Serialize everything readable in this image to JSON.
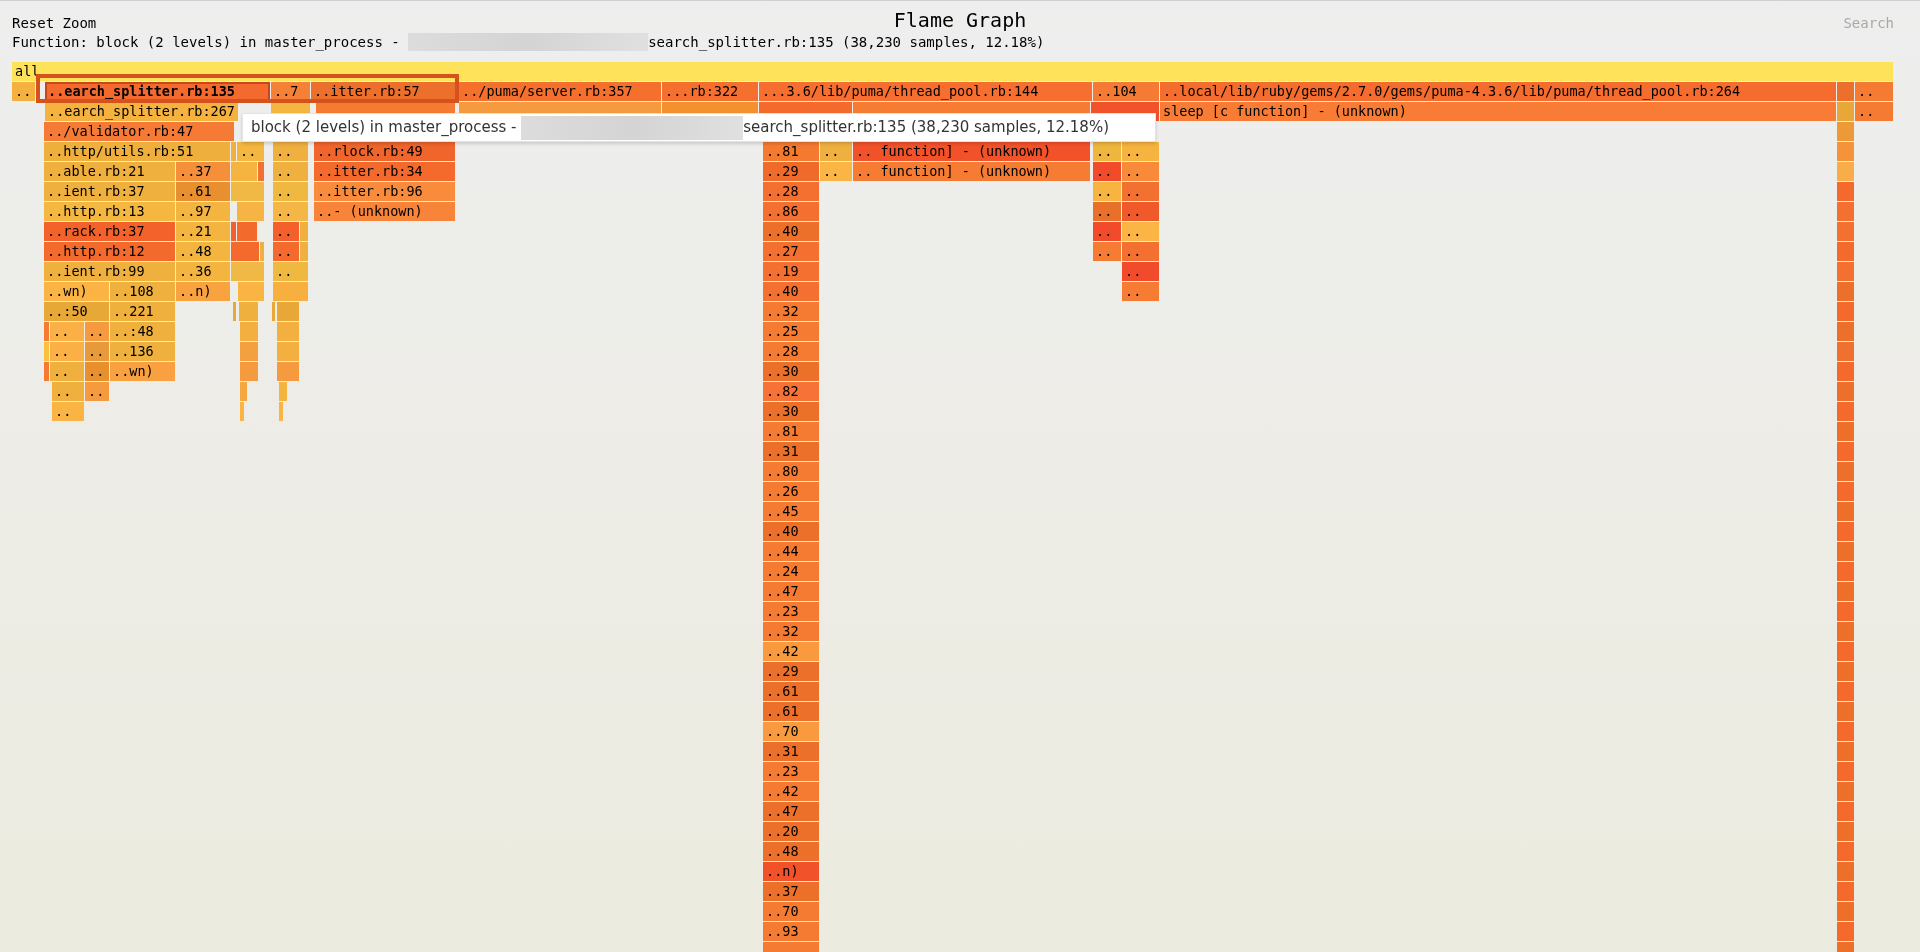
{
  "header": {
    "reset_zoom": "Reset Zoom",
    "title": "Flame Graph",
    "search": "Search"
  },
  "details": {
    "prefix": "Function: block (2 levels) in master_process - ",
    "redacted": true,
    "suffix": "search_splitter.rb:135 (38,230 samples, 12.18%)"
  },
  "tooltip": {
    "prefix": "block (2 levels) in master_process - ",
    "redacted": true,
    "suffix": "search_splitter.rb:135 (38,230 samples, 12.18%)"
  },
  "flame": {
    "rows": [
      {
        "frames": [
          {
            "label": "all",
            "color": "#fde25a",
            "selected": false
          }
        ]
      },
      {
        "frames": [
          {
            "label": "..",
            "color": "#f5b13f",
            "selected": false
          },
          {
            "label": "..earch_splitter.rb:135",
            "color": "#f46a2e",
            "selected": true
          },
          {
            "label": "..7",
            "color": "#f58136",
            "selected": false
          },
          {
            "label": "..itter.rb:57",
            "color": "#ec6f2b",
            "selected": false
          },
          {
            "label": "../puma/server.rb:357",
            "color": "#f5702c",
            "selected": false
          },
          {
            "label": "...rb:322",
            "color": "#f5702f",
            "selected": false
          },
          {
            "label": "...3.6/lib/puma/thread_pool.rb:144",
            "color": "#f76f30",
            "selected": false
          },
          {
            "label": "..104",
            "color": "#f57a33",
            "selected": false
          },
          {
            "label": "..local/lib/ruby/gems/2.7.0/gems/puma-4.3.6/lib/puma/thread_pool.rb:264",
            "color": "#f46d2e",
            "selected": false
          },
          {
            "color": "#ec6f2b",
            "selected": false
          },
          {
            "label": "..",
            "color": "#f57a32",
            "selected": false
          }
        ]
      },
      {
        "frames": [
          {
            "label": "..earch_splitter.rb:267",
            "color": "#f5b23f",
            "selected": false
          },
          {
            "color": "#f3b640",
            "selected": false
          },
          {
            "color": "#f57a32",
            "selected": false
          },
          {
            "color": "#f59a3e",
            "selected": false
          },
          {
            "color": "#f5902f",
            "selected": false
          },
          {
            "color": "#f46a2c",
            "selected": false
          },
          {
            "color": "#f67c34",
            "selected": false
          },
          {
            "color": "#f2522a",
            "selected": false
          },
          {
            "label": "sleep [c function] - (unknown)",
            "color": "#f87c36",
            "selected": false
          },
          {
            "color": "#e8a838",
            "selected": false
          },
          {
            "label": "..",
            "color": "#f57a32",
            "selected": false
          }
        ]
      },
      {
        "frames": [
          {
            "label": "../validator.rb:47",
            "color": "#f47a36",
            "selected": false
          },
          {
            "color": "#ec9a38",
            "selected": false
          }
        ]
      },
      {
        "frames": [
          {
            "label": "..http/utils.rb:51",
            "color": "#efaf3c",
            "selected": false
          },
          {
            "color": "#f0b040",
            "selected": false
          },
          {
            "label": "..",
            "color": "#f3b640",
            "selected": false
          },
          {
            "label": "..",
            "color": "#f0b040",
            "selected": false
          },
          {
            "label": "..rlock.rb:49",
            "color": "#f0652c",
            "selected": false
          },
          {
            "label": "..81",
            "color": "#f47a30",
            "selected": false
          },
          {
            "label": "..",
            "color": "#f0b040",
            "selected": false
          },
          {
            "label": ".. function] - (unknown)",
            "color": "#f2522a",
            "selected": false
          },
          {
            "label": "..",
            "color": "#efb63e",
            "selected": false
          },
          {
            "label": "..",
            "color": "#f7b340",
            "selected": false
          },
          {
            "color": "#f5933a",
            "selected": false
          }
        ]
      },
      {
        "frames": [
          {
            "label": "..able.rb:21",
            "color": "#efb03e",
            "selected": false
          },
          {
            "label": "..37",
            "color": "#f58f3a",
            "selected": false
          },
          {
            "color": "#f5b440",
            "selected": false
          },
          {
            "color": "#f27030",
            "selected": false
          },
          {
            "label": "..",
            "color": "#f0b040",
            "selected": false
          },
          {
            "label": "..itter.rb:34",
            "color": "#f46a2c",
            "selected": false
          },
          {
            "label": "..29",
            "color": "#f06a2a",
            "selected": false
          },
          {
            "label": "..",
            "color": "#fab545",
            "selected": false
          },
          {
            "label": ".. function] - (unknown)",
            "color": "#f67c34",
            "selected": false
          },
          {
            "label": "..",
            "color": "#f24b2c",
            "selected": false
          },
          {
            "label": "..",
            "color": "#f98a3a",
            "selected": false
          },
          {
            "color": "#f9ad48",
            "selected": false
          }
        ]
      },
      {
        "frames": [
          {
            "label": "..ient.rb:37",
            "color": "#efb03e",
            "selected": false
          },
          {
            "label": "..61",
            "color": "#e89030",
            "selected": false
          },
          {
            "color": "#f0b844",
            "selected": false
          },
          {
            "label": "..",
            "color": "#efb840",
            "selected": false
          },
          {
            "label": "..itter.rb:96",
            "color": "#f88c3c",
            "selected": false
          },
          {
            "label": "..28",
            "color": "#f47030",
            "selected": false
          },
          {
            "label": "..",
            "color": "#f7b440",
            "selected": false
          },
          {
            "label": "..",
            "color": "#f27030",
            "selected": false
          },
          {
            "color": "#f46a2c",
            "selected": false
          }
        ]
      },
      {
        "frames": [
          {
            "label": "..http.rb:13",
            "color": "#f4b840",
            "selected": false
          },
          {
            "label": "..97",
            "color": "#f3b440",
            "selected": false
          },
          {
            "color": "#f5b444",
            "selected": false
          },
          {
            "label": "..",
            "color": "#f4b644",
            "selected": false
          },
          {
            "label": "..- (unknown)",
            "color": "#f8843a",
            "selected": false
          },
          {
            "label": "..86",
            "color": "#f47030",
            "selected": false
          },
          {
            "label": "..",
            "color": "#e8702a",
            "selected": false
          },
          {
            "label": "..",
            "color": "#f05a2a",
            "selected": false
          },
          {
            "color": "#f47030",
            "selected": false
          }
        ]
      },
      {
        "frames": [
          {
            "label": "..rack.rb:37",
            "color": "#f2622a",
            "selected": false
          },
          {
            "label": "..21",
            "color": "#f3b440",
            "selected": false
          },
          {
            "color": "#f06030",
            "selected": false
          },
          {
            "color": "#f26a2c",
            "selected": false
          },
          {
            "label": "..",
            "color": "#f4602c",
            "selected": false
          },
          {
            "color": "#f0b040",
            "selected": false
          },
          {
            "label": "..40",
            "color": "#ec702a",
            "selected": false
          },
          {
            "label": "..",
            "color": "#f24b2c",
            "selected": false
          },
          {
            "label": "..",
            "color": "#fab545",
            "selected": false
          },
          {
            "color": "#f47030",
            "selected": false
          }
        ]
      },
      {
        "frames": [
          {
            "label": "..http.rb:12",
            "color": "#f46a2c",
            "selected": false
          },
          {
            "label": "..48",
            "color": "#f3b440",
            "selected": false
          },
          {
            "color": "#f46a2c",
            "selected": false
          },
          {
            "color": "#f0b040",
            "selected": false
          },
          {
            "label": "..",
            "color": "#f46a2c",
            "selected": false
          },
          {
            "color": "#f0b040",
            "selected": false
          },
          {
            "label": "..27",
            "color": "#f47030",
            "selected": false
          },
          {
            "label": "..",
            "color": "#f67c34",
            "selected": false
          },
          {
            "label": "..",
            "color": "#f47030",
            "selected": false
          },
          {
            "color": "#f46a2c",
            "selected": false
          }
        ]
      },
      {
        "frames": [
          {
            "label": "..ient.rb:99",
            "color": "#efb03e",
            "selected": false
          },
          {
            "label": "..36",
            "color": "#f3b440",
            "selected": false
          },
          {
            "color": "#f0b844",
            "selected": false
          },
          {
            "label": "..",
            "color": "#efb840",
            "selected": false
          },
          {
            "label": "..19",
            "color": "#f47030",
            "selected": false
          },
          {
            "label": "..",
            "color": "#f24b2c",
            "selected": false
          },
          {
            "color": "#f47030",
            "selected": false
          }
        ]
      },
      {
        "frames": [
          {
            "label": "..wn)",
            "color": "#fbb444",
            "selected": false
          },
          {
            "label": "..108",
            "color": "#efb03e",
            "selected": false
          },
          {
            "label": "..n)",
            "color": "#f9a240",
            "selected": false
          },
          {
            "color": "#f9b444",
            "selected": false
          },
          {
            "color": "#f7b040",
            "selected": false
          },
          {
            "label": "..40",
            "color": "#f47030",
            "selected": false
          },
          {
            "label": "..",
            "color": "#f67c34",
            "selected": false
          },
          {
            "color": "#ec702a",
            "selected": false
          }
        ]
      },
      {
        "frames": [
          {
            "label": "..:50",
            "color": "#e8a838",
            "selected": false
          },
          {
            "label": "..221",
            "color": "#efb03e",
            "selected": false
          },
          {
            "color": "#e8a838",
            "selected": false
          },
          {
            "color": "#efb03e",
            "selected": false
          },
          {
            "color": "#e8a838",
            "selected": false
          },
          {
            "color": "#e8a838",
            "selected": false
          },
          {
            "label": "..32",
            "color": "#f57a32",
            "selected": false
          },
          {
            "color": "#f46a2c",
            "selected": false
          }
        ]
      },
      {
        "frames": [
          {
            "color": "#f57a32",
            "selected": false
          },
          {
            "label": "..",
            "color": "#fbb045",
            "selected": false
          },
          {
            "label": "..",
            "color": "#f59a3e",
            "selected": false
          },
          {
            "label": "..:48",
            "color": "#efb03e",
            "selected": false
          },
          {
            "color": "#f3b040",
            "selected": false
          },
          {
            "color": "#f3b040",
            "selected": false
          },
          {
            "label": "..25",
            "color": "#f57a32",
            "selected": false
          },
          {
            "color": "#ec702a",
            "selected": false
          }
        ]
      },
      {
        "frames": [
          {
            "color": "#fbc040",
            "selected": false
          },
          {
            "label": "..",
            "color": "#fbb045",
            "selected": false
          },
          {
            "label": "..",
            "color": "#e89a38",
            "selected": false
          },
          {
            "label": "..136",
            "color": "#efb03e",
            "selected": false
          },
          {
            "color": "#f3a040",
            "selected": false
          },
          {
            "color": "#f3b040",
            "selected": false
          },
          {
            "label": "..28",
            "color": "#f57a32",
            "selected": false
          },
          {
            "color": "#f07030",
            "selected": false
          }
        ]
      },
      {
        "frames": [
          {
            "color": "#f57a32",
            "selected": false
          },
          {
            "label": "..",
            "color": "#efb03e",
            "selected": false
          },
          {
            "label": "..",
            "color": "#e8902e",
            "selected": false
          },
          {
            "label": "..wn)",
            "color": "#f9a040",
            "selected": false
          },
          {
            "color": "#f59a3e",
            "selected": false
          },
          {
            "color": "#f59a3e",
            "selected": false
          },
          {
            "label": "..30",
            "color": "#ec702a",
            "selected": false
          },
          {
            "color": "#f46a2c",
            "selected": false
          }
        ]
      },
      {
        "frames": [
          {
            "label": "..",
            "color": "#efb03e",
            "selected": false
          },
          {
            "label": "..",
            "color": "#f59a3e",
            "selected": false
          },
          {
            "color": "#f5a840",
            "selected": false
          },
          {
            "color": "#f3b440",
            "selected": false
          },
          {
            "label": "..82",
            "color": "#f67236",
            "selected": false
          },
          {
            "color": "#ec702a",
            "selected": false
          }
        ]
      },
      {
        "frames": [
          {
            "label": "..",
            "color": "#f9b444",
            "selected": false
          },
          {
            "color": "#f9b444",
            "selected": false
          },
          {
            "color": "#f9b444",
            "selected": false
          },
          {
            "label": "..30",
            "color": "#ec702a",
            "selected": false
          },
          {
            "color": "#f46a2c",
            "selected": false
          }
        ]
      },
      {
        "frames": [
          {
            "label": "..81",
            "color": "#f57a32",
            "selected": false
          },
          {
            "color": "#ec702a",
            "selected": false
          }
        ]
      },
      {
        "frames": [
          {
            "label": "..31",
            "color": "#ec702a",
            "selected": false
          },
          {
            "color": "#f46a2c",
            "selected": false
          }
        ]
      },
      {
        "frames": [
          {
            "label": "..80",
            "color": "#f57a32",
            "selected": false
          },
          {
            "color": "#ec702a",
            "selected": false
          }
        ]
      },
      {
        "frames": [
          {
            "label": "..26",
            "color": "#f57a32",
            "selected": false
          },
          {
            "color": "#f46a2c",
            "selected": false
          }
        ]
      },
      {
        "frames": [
          {
            "label": "..45",
            "color": "#f57a32",
            "selected": false
          },
          {
            "color": "#ec702a",
            "selected": false
          }
        ]
      },
      {
        "frames": [
          {
            "label": "..40",
            "color": "#ec702a",
            "selected": false
          },
          {
            "color": "#f46a2c",
            "selected": false
          }
        ]
      },
      {
        "frames": [
          {
            "label": "..44",
            "color": "#f57a32",
            "selected": false
          },
          {
            "color": "#ec702a",
            "selected": false
          }
        ]
      },
      {
        "frames": [
          {
            "label": "..24",
            "color": "#f57a32",
            "selected": false
          },
          {
            "color": "#f46a2c",
            "selected": false
          }
        ]
      },
      {
        "frames": [
          {
            "label": "..47",
            "color": "#f57a32",
            "selected": false
          },
          {
            "color": "#ec702a",
            "selected": false
          }
        ]
      },
      {
        "frames": [
          {
            "label": "..23",
            "color": "#f57a32",
            "selected": false
          },
          {
            "color": "#f46a2c",
            "selected": false
          }
        ]
      },
      {
        "frames": [
          {
            "label": "..32",
            "color": "#f57a32",
            "selected": false
          },
          {
            "color": "#ec702a",
            "selected": false
          }
        ]
      },
      {
        "frames": [
          {
            "label": "..42",
            "color": "#f99a3e",
            "selected": false
          },
          {
            "color": "#f46a2c",
            "selected": false
          }
        ]
      },
      {
        "frames": [
          {
            "label": "..29",
            "color": "#ec702a",
            "selected": false
          },
          {
            "color": "#ec702a",
            "selected": false
          }
        ]
      },
      {
        "frames": [
          {
            "label": "..61",
            "color": "#ec702a",
            "selected": false
          },
          {
            "color": "#f46a2c",
            "selected": false
          }
        ]
      },
      {
        "frames": [
          {
            "label": "..61",
            "color": "#ec702a",
            "selected": false
          },
          {
            "color": "#ec702a",
            "selected": false
          }
        ]
      },
      {
        "frames": [
          {
            "label": "..70",
            "color": "#f99a3e",
            "selected": false
          },
          {
            "color": "#f46a2c",
            "selected": false
          }
        ]
      },
      {
        "frames": [
          {
            "label": "..31",
            "color": "#ec702a",
            "selected": false
          },
          {
            "color": "#ec702a",
            "selected": false
          }
        ]
      },
      {
        "frames": [
          {
            "label": "..23",
            "color": "#f57a32",
            "selected": false
          },
          {
            "color": "#f46a2c",
            "selected": false
          }
        ]
      },
      {
        "frames": [
          {
            "label": "..42",
            "color": "#f57a32",
            "selected": false
          },
          {
            "color": "#ec702a",
            "selected": false
          }
        ]
      },
      {
        "frames": [
          {
            "label": "..47",
            "color": "#ec702a",
            "selected": false
          },
          {
            "color": "#f46a2c",
            "selected": false
          }
        ]
      },
      {
        "frames": [
          {
            "label": "..20",
            "color": "#ec702a",
            "selected": false
          },
          {
            "color": "#ec702a",
            "selected": false
          }
        ]
      },
      {
        "frames": [
          {
            "label": "..48",
            "color": "#ec702a",
            "selected": false
          },
          {
            "color": "#f46a2c",
            "selected": false
          }
        ]
      },
      {
        "frames": [
          {
            "label": "..n)",
            "color": "#f2522a",
            "selected": false
          },
          {
            "color": "#ec702a",
            "selected": false
          }
        ]
      },
      {
        "frames": [
          {
            "label": "..37",
            "color": "#ec702a",
            "selected": false
          },
          {
            "color": "#f46a2c",
            "selected": false
          }
        ]
      },
      {
        "frames": [
          {
            "label": "..70",
            "color": "#f57a32",
            "selected": false
          },
          {
            "color": "#ec702a",
            "selected": false
          }
        ]
      },
      {
        "frames": [
          {
            "label": "..93",
            "color": "#f57a32",
            "selected": false
          },
          {
            "color": "#f46a2c",
            "selected": false
          }
        ]
      },
      {
        "frames": [
          {
            "color": "#f57a32",
            "selected": false
          },
          {
            "color": "#ec702a",
            "selected": false
          }
        ]
      }
    ]
  }
}
